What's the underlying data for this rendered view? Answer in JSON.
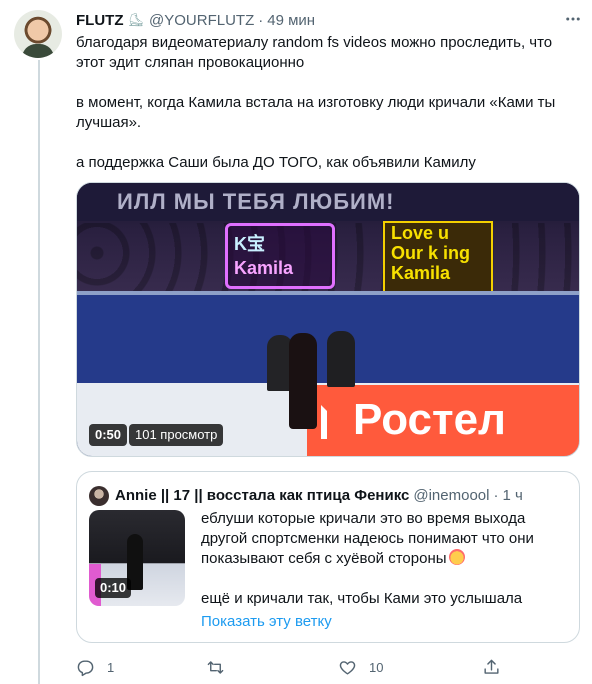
{
  "tweet": {
    "author_name": "FLUTZ",
    "author_emoji": "⛸",
    "handle": "@YOURFLUTZ",
    "separator": "·",
    "time": "49 мин",
    "more_icon": "more-dots-icon",
    "paragraphs": [
      "благодаря видеоматериалу random fs videos можно проследить, что этот эдит сляпан провокационно",
      "в момент, когда Камила встала на изготовку люди кричали «Ками ты лучшая».",
      "а поддержка Саши была ДО ТОГО, как объявили Камилу"
    ]
  },
  "media": {
    "duration": "0:50",
    "views": "101 просмотр",
    "scene_banner": "ИЛЛ МЫ ТЕБЯ ЛЮБИМ!",
    "sign_left_lines": [
      "K宝",
      "Kamila"
    ],
    "sign_right_lines": [
      "Love u",
      "Our k ing",
      "Kamila"
    ],
    "adboard": "Ростел"
  },
  "quote": {
    "author_name": "Annie || 17 || восстала как птица Феникс",
    "handle": "@inemoool",
    "separator": "·",
    "time": "1 ч",
    "thumb_duration": "0:10",
    "paragraph1": "еблуши которые кричали это во время выхода другой спортсменки надеюсь понимают что они показывают себя с хуёвой стороны",
    "paragraph2": "ещё и кричали так, чтобы Ками это услышала",
    "emoji_name": "clown-face-icon",
    "show_thread": "Показать эту ветку"
  },
  "actions": {
    "reply_count": "1",
    "retweet_count": "",
    "like_count": "10",
    "share_count": ""
  },
  "colors": {
    "text": "#0f1419",
    "secondary": "#536471",
    "link": "#1d9bf0",
    "border": "#cfd9de"
  }
}
